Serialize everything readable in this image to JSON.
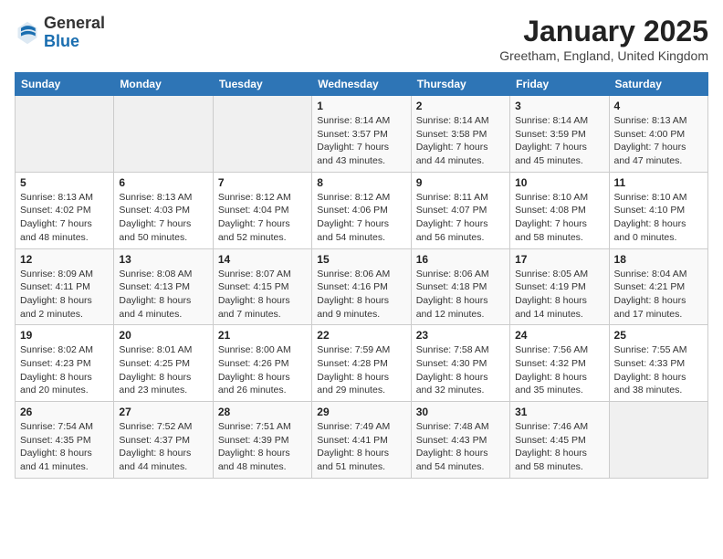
{
  "header": {
    "logo_general": "General",
    "logo_blue": "Blue",
    "title": "January 2025",
    "subtitle": "Greetham, England, United Kingdom"
  },
  "days_of_week": [
    "Sunday",
    "Monday",
    "Tuesday",
    "Wednesday",
    "Thursday",
    "Friday",
    "Saturday"
  ],
  "weeks": [
    [
      {
        "day": "",
        "info": ""
      },
      {
        "day": "",
        "info": ""
      },
      {
        "day": "",
        "info": ""
      },
      {
        "day": "1",
        "info": "Sunrise: 8:14 AM\nSunset: 3:57 PM\nDaylight: 7 hours and 43 minutes."
      },
      {
        "day": "2",
        "info": "Sunrise: 8:14 AM\nSunset: 3:58 PM\nDaylight: 7 hours and 44 minutes."
      },
      {
        "day": "3",
        "info": "Sunrise: 8:14 AM\nSunset: 3:59 PM\nDaylight: 7 hours and 45 minutes."
      },
      {
        "day": "4",
        "info": "Sunrise: 8:13 AM\nSunset: 4:00 PM\nDaylight: 7 hours and 47 minutes."
      }
    ],
    [
      {
        "day": "5",
        "info": "Sunrise: 8:13 AM\nSunset: 4:02 PM\nDaylight: 7 hours and 48 minutes."
      },
      {
        "day": "6",
        "info": "Sunrise: 8:13 AM\nSunset: 4:03 PM\nDaylight: 7 hours and 50 minutes."
      },
      {
        "day": "7",
        "info": "Sunrise: 8:12 AM\nSunset: 4:04 PM\nDaylight: 7 hours and 52 minutes."
      },
      {
        "day": "8",
        "info": "Sunrise: 8:12 AM\nSunset: 4:06 PM\nDaylight: 7 hours and 54 minutes."
      },
      {
        "day": "9",
        "info": "Sunrise: 8:11 AM\nSunset: 4:07 PM\nDaylight: 7 hours and 56 minutes."
      },
      {
        "day": "10",
        "info": "Sunrise: 8:10 AM\nSunset: 4:08 PM\nDaylight: 7 hours and 58 minutes."
      },
      {
        "day": "11",
        "info": "Sunrise: 8:10 AM\nSunset: 4:10 PM\nDaylight: 8 hours and 0 minutes."
      }
    ],
    [
      {
        "day": "12",
        "info": "Sunrise: 8:09 AM\nSunset: 4:11 PM\nDaylight: 8 hours and 2 minutes."
      },
      {
        "day": "13",
        "info": "Sunrise: 8:08 AM\nSunset: 4:13 PM\nDaylight: 8 hours and 4 minutes."
      },
      {
        "day": "14",
        "info": "Sunrise: 8:07 AM\nSunset: 4:15 PM\nDaylight: 8 hours and 7 minutes."
      },
      {
        "day": "15",
        "info": "Sunrise: 8:06 AM\nSunset: 4:16 PM\nDaylight: 8 hours and 9 minutes."
      },
      {
        "day": "16",
        "info": "Sunrise: 8:06 AM\nSunset: 4:18 PM\nDaylight: 8 hours and 12 minutes."
      },
      {
        "day": "17",
        "info": "Sunrise: 8:05 AM\nSunset: 4:19 PM\nDaylight: 8 hours and 14 minutes."
      },
      {
        "day": "18",
        "info": "Sunrise: 8:04 AM\nSunset: 4:21 PM\nDaylight: 8 hours and 17 minutes."
      }
    ],
    [
      {
        "day": "19",
        "info": "Sunrise: 8:02 AM\nSunset: 4:23 PM\nDaylight: 8 hours and 20 minutes."
      },
      {
        "day": "20",
        "info": "Sunrise: 8:01 AM\nSunset: 4:25 PM\nDaylight: 8 hours and 23 minutes."
      },
      {
        "day": "21",
        "info": "Sunrise: 8:00 AM\nSunset: 4:26 PM\nDaylight: 8 hours and 26 minutes."
      },
      {
        "day": "22",
        "info": "Sunrise: 7:59 AM\nSunset: 4:28 PM\nDaylight: 8 hours and 29 minutes."
      },
      {
        "day": "23",
        "info": "Sunrise: 7:58 AM\nSunset: 4:30 PM\nDaylight: 8 hours and 32 minutes."
      },
      {
        "day": "24",
        "info": "Sunrise: 7:56 AM\nSunset: 4:32 PM\nDaylight: 8 hours and 35 minutes."
      },
      {
        "day": "25",
        "info": "Sunrise: 7:55 AM\nSunset: 4:33 PM\nDaylight: 8 hours and 38 minutes."
      }
    ],
    [
      {
        "day": "26",
        "info": "Sunrise: 7:54 AM\nSunset: 4:35 PM\nDaylight: 8 hours and 41 minutes."
      },
      {
        "day": "27",
        "info": "Sunrise: 7:52 AM\nSunset: 4:37 PM\nDaylight: 8 hours and 44 minutes."
      },
      {
        "day": "28",
        "info": "Sunrise: 7:51 AM\nSunset: 4:39 PM\nDaylight: 8 hours and 48 minutes."
      },
      {
        "day": "29",
        "info": "Sunrise: 7:49 AM\nSunset: 4:41 PM\nDaylight: 8 hours and 51 minutes."
      },
      {
        "day": "30",
        "info": "Sunrise: 7:48 AM\nSunset: 4:43 PM\nDaylight: 8 hours and 54 minutes."
      },
      {
        "day": "31",
        "info": "Sunrise: 7:46 AM\nSunset: 4:45 PM\nDaylight: 8 hours and 58 minutes."
      },
      {
        "day": "",
        "info": ""
      }
    ]
  ]
}
